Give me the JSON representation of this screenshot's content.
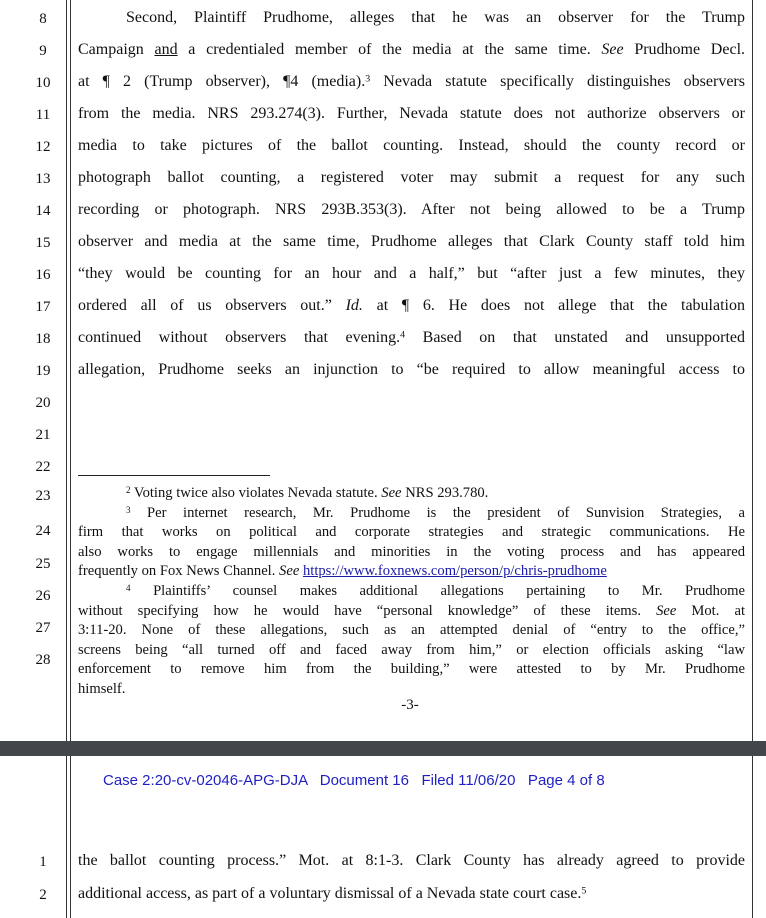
{
  "page3": {
    "line_numbers": [
      "8",
      "9",
      "10",
      "11",
      "12",
      "13",
      "14",
      "15",
      "16",
      "17",
      "18",
      "19",
      "20",
      "21",
      "22",
      "23",
      "24",
      "25",
      "26",
      "27",
      "28"
    ],
    "body_lines": [
      [
        {
          "t": "Second, Plaintiff Prudhome, alleges that he was an observer for the Trump"
        }
      ],
      [
        {
          "t": "Campaign "
        },
        {
          "t": "and",
          "s": "u"
        },
        {
          "t": " a credentialed member of the media at the same time. "
        },
        {
          "t": "See",
          "s": "i"
        },
        {
          "t": " Prudhome Decl."
        }
      ],
      [
        {
          "t": "at ¶ 2 (Trump observer), ¶4 (media)."
        },
        {
          "t": "3",
          "s": "sup"
        },
        {
          "t": " Nevada statute specifically distinguishes observers"
        }
      ],
      [
        {
          "t": "from the media. NRS 293.274(3). Further, Nevada statute does not authorize observers or"
        }
      ],
      [
        {
          "t": "media to take pictures of the ballot counting. Instead, should the county record or"
        }
      ],
      [
        {
          "t": "photograph ballot counting, a registered voter may submit a request for any such"
        }
      ],
      [
        {
          "t": "recording or photograph. NRS 293B.353(3). After not being allowed to be a Trump"
        }
      ],
      [
        {
          "t": "observer and media at the same time, Prudhome alleges that Clark County staff told him"
        }
      ],
      [
        {
          "t": "“they would be counting for an hour and a half,” but “after just a few minutes, they"
        }
      ],
      [
        {
          "t": "ordered all of us observers out.” "
        },
        {
          "t": "Id.",
          "s": "i"
        },
        {
          "t": " at ¶ 6. He does not allege that the tabulation"
        }
      ],
      [
        {
          "t": "continued without observers that evening."
        },
        {
          "t": "4",
          "s": "sup"
        },
        {
          "t": " Based on that unstated and unsupported"
        }
      ],
      [
        {
          "t": "allegation, Prudhome seeks an injunction to “be required to allow meaningful access to"
        }
      ]
    ],
    "footnote_lines": [
      {
        "ind": true,
        "j": false,
        "segs": [
          {
            "t": "2",
            "s": "sup"
          },
          {
            "t": " Voting twice also violates Nevada statute. "
          },
          {
            "t": "See",
            "s": "i"
          },
          {
            "t": " NRS 293.780."
          }
        ]
      },
      {
        "ind": true,
        "j": true,
        "segs": [
          {
            "t": "3",
            "s": "sup"
          },
          {
            "t": " Per internet research, Mr. Prudhome is the president of Sunvision Strategies, a"
          }
        ]
      },
      {
        "ind": false,
        "j": true,
        "segs": [
          {
            "t": "firm that works on political and corporate strategies and strategic communications. He"
          }
        ]
      },
      {
        "ind": false,
        "j": true,
        "segs": [
          {
            "t": "also works to engage millennials and minorities in the voting process and has appeared"
          }
        ]
      },
      {
        "ind": false,
        "j": false,
        "segs": [
          {
            "t": "frequently on Fox News Channel. "
          },
          {
            "t": "See",
            "s": "i"
          },
          {
            "t": " "
          },
          {
            "t": "https://www.foxnews.com/person/p/chris-prudhome",
            "s": "link"
          }
        ]
      },
      {
        "ind": true,
        "j": true,
        "segs": [
          {
            "t": "4",
            "s": "sup"
          },
          {
            "t": " Plaintiffs’ counsel makes additional allegations pertaining to Mr. Prudhome"
          }
        ]
      },
      {
        "ind": false,
        "j": true,
        "segs": [
          {
            "t": "without specifying how he would have “personal knowledge” of these items. "
          },
          {
            "t": "See",
            "s": "i"
          },
          {
            "t": " Mot. at"
          }
        ]
      },
      {
        "ind": false,
        "j": true,
        "segs": [
          {
            "t": "3:11-20. None of these allegations, such as an attempted denial of “entry to the office,”"
          }
        ]
      },
      {
        "ind": false,
        "j": true,
        "segs": [
          {
            "t": "screens being “all turned off and faced away from him,” or election officials asking “law"
          }
        ]
      },
      {
        "ind": false,
        "j": true,
        "segs": [
          {
            "t": "enforcement to remove him from the building,” were attested to by Mr. Prudhome"
          }
        ]
      },
      {
        "ind": false,
        "j": false,
        "segs": [
          {
            "t": "himself."
          }
        ]
      }
    ],
    "page_number": "-3-"
  },
  "page4": {
    "header": "Case 2:20-cv-02046-APG-DJA   Document 16   Filed 11/06/20   Page 4 of 8",
    "header_color": "#1f1fc4",
    "line_numbers": [
      "1",
      "2"
    ],
    "body_lines": [
      [
        {
          "t": "the ballot counting process.” Mot. at 8:1-3. Clark County has already agreed to provide"
        }
      ],
      [
        {
          "t": "additional access, as part of a voluntary dismissal of a Nevada state court case."
        },
        {
          "t": "5",
          "s": "sup"
        }
      ]
    ]
  }
}
